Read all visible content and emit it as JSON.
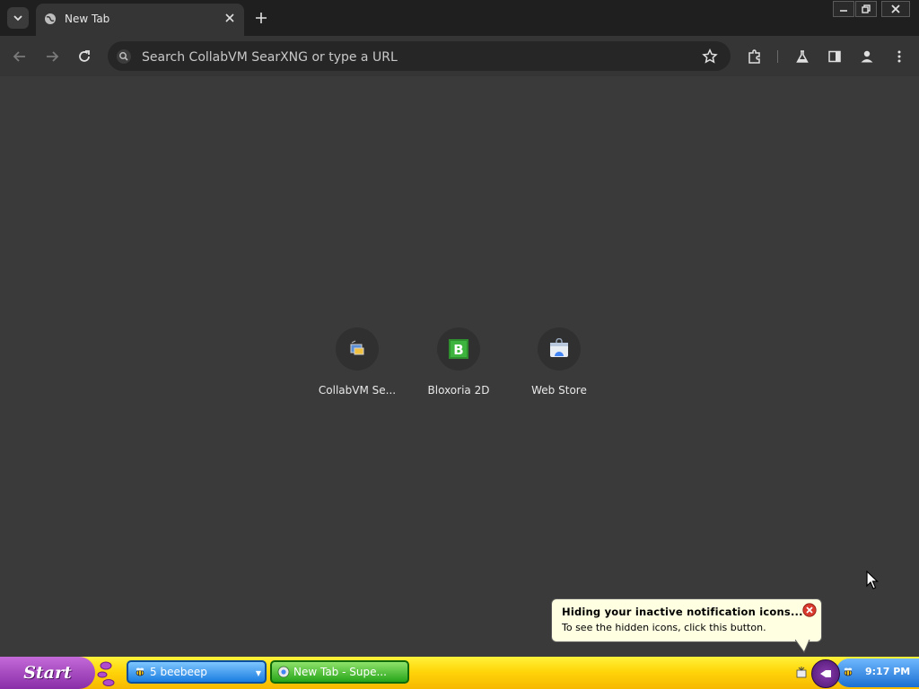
{
  "browser": {
    "tab": {
      "title": "New Tab"
    },
    "omnibox": {
      "placeholder": "Search CollabVM SearXNG or type a URL"
    }
  },
  "shortcuts": [
    {
      "label": "CollabVM Se...",
      "icon": "collabvm-icon"
    },
    {
      "label": "Bloxoria 2D",
      "icon": "bloxoria-icon"
    },
    {
      "label": "Web Store",
      "icon": "web-store-icon"
    }
  ],
  "balloon": {
    "title": "Hiding your inactive notification icons...",
    "text": "To see the hidden icons, click this button."
  },
  "taskbar": {
    "start_label": "Start",
    "tasks": [
      {
        "label": "5 beebeep",
        "icon": "bee-icon"
      },
      {
        "label": "New Tab - Supe...",
        "icon": "browser-icon"
      }
    ],
    "clock": "9:17 PM"
  },
  "colors": {
    "background": "#3a3a3a",
    "tab_strip": "#1f1f1f",
    "toolbar": "#353535",
    "taskbar": "#ffd60a",
    "start_button": "#8a2ea8"
  }
}
